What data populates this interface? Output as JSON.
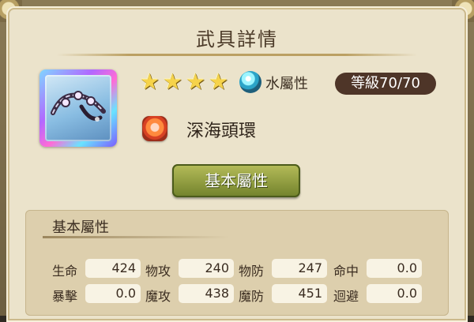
{
  "title": "武具詳情",
  "weapon": {
    "rarity": 4,
    "stars": [
      "★",
      "★",
      "★",
      "★"
    ],
    "element_icon": "water-element-icon",
    "element_label": "水屬性",
    "level_label": "等級70/70",
    "skill_icon": "fire-swirl-icon",
    "name": "深海頭環"
  },
  "button": {
    "basic_attributes": "基本屬性"
  },
  "stats": {
    "header": "基本屬性",
    "rows": [
      [
        {
          "label": "生命",
          "value": "424"
        },
        {
          "label": "物攻",
          "value": "240"
        },
        {
          "label": "物防",
          "value": "247"
        },
        {
          "label": "命中",
          "value": "0.0"
        }
      ],
      [
        {
          "label": "暴擊",
          "value": "0.0"
        },
        {
          "label": "魔攻",
          "value": "438"
        },
        {
          "label": "魔防",
          "value": "451"
        },
        {
          "label": "迴避",
          "value": "0.0"
        }
      ]
    ]
  }
}
